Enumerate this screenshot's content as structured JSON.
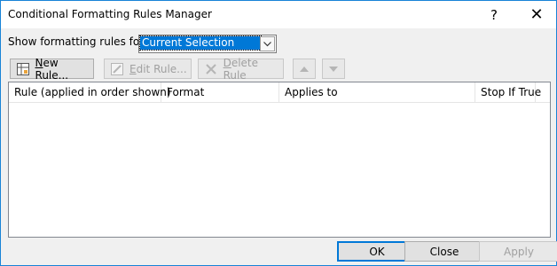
{
  "window": {
    "title": "Conditional Formatting Rules Manager",
    "help_label": "?",
    "close_label": "✕"
  },
  "scope": {
    "label": "Show formatting rules for:",
    "selected": "Current Selection"
  },
  "toolbar": {
    "new_rule": {
      "mnemonic": "N",
      "rest": "ew Rule..."
    },
    "edit_rule": {
      "mnemonic": "E",
      "rest": "dit Rule..."
    },
    "delete_rule": {
      "mnemonic": "D",
      "rest": "elete Rule"
    }
  },
  "table": {
    "columns": [
      "Rule (applied in order shown)",
      "Format",
      "Applies to",
      "Stop If True"
    ],
    "rows": []
  },
  "buttons": {
    "ok": "OK",
    "close": "Close",
    "apply": "Apply"
  },
  "colors": {
    "accent": "#0078d7",
    "border": "#1883d7"
  }
}
